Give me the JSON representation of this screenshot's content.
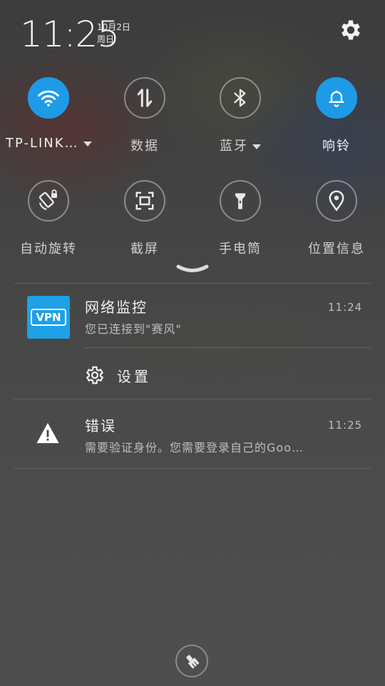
{
  "status": {
    "time": "11:25",
    "date": "10月2日",
    "weekday": "周日"
  },
  "quick_settings": [
    {
      "name": "wifi",
      "label": "TP-LINK…",
      "active": true,
      "has_dropdown": true,
      "icon": "wifi-icon"
    },
    {
      "name": "data",
      "label": "数据",
      "active": false,
      "has_dropdown": false,
      "icon": "mobile-data-icon"
    },
    {
      "name": "bluetooth",
      "label": "蓝牙",
      "active": false,
      "has_dropdown": true,
      "icon": "bluetooth-icon"
    },
    {
      "name": "ringer",
      "label": "响铃",
      "active": true,
      "has_dropdown": false,
      "icon": "bell-icon"
    },
    {
      "name": "auto-rotate",
      "label": "自动旋转",
      "active": false,
      "has_dropdown": false,
      "icon": "rotate-lock-icon"
    },
    {
      "name": "screenshot",
      "label": "截屏",
      "active": false,
      "has_dropdown": false,
      "icon": "screenshot-icon"
    },
    {
      "name": "flashlight",
      "label": "手电筒",
      "active": false,
      "has_dropdown": false,
      "icon": "flashlight-icon"
    },
    {
      "name": "location",
      "label": "位置信息",
      "active": false,
      "has_dropdown": false,
      "icon": "location-icon"
    }
  ],
  "notifications": [
    {
      "app_icon": "vpn-icon",
      "app_icon_text": "VPN",
      "title": "网络监控",
      "text": "您已连接到\"赛风\"",
      "time": "11:24",
      "action": {
        "icon": "gear-icon",
        "label": "设置"
      }
    },
    {
      "app_icon": "warning-icon",
      "title": "错误",
      "text": "需要验证身份。您需要登录自己的Goo…",
      "time": "11:25"
    }
  ],
  "colors": {
    "accent": "#1e9be6",
    "background": "#4a4a4a"
  }
}
